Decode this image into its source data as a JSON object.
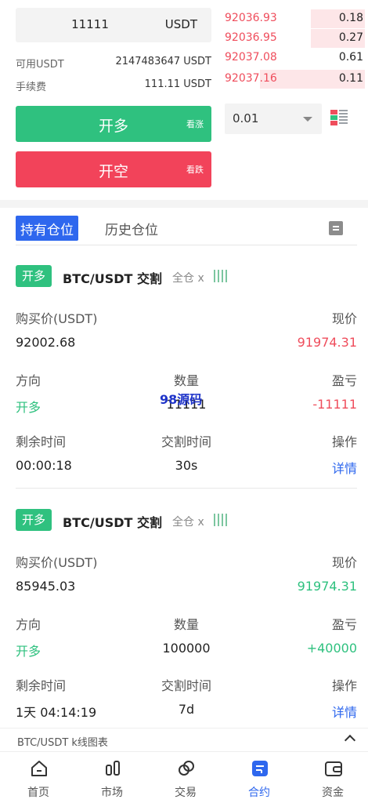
{
  "trade_form": {
    "amount_value": "11111",
    "amount_unit": "USDT",
    "available_label": "可用USDT",
    "available_value": "2147483647 USDT",
    "fee_label": "手续费",
    "fee_value": "111.11 USDT",
    "long_button": {
      "label": "开多",
      "sublabel": "看涨"
    },
    "short_button": {
      "label": "开空",
      "sublabel": "看跌"
    }
  },
  "order_book": {
    "asks": [
      {
        "price": "92036.93",
        "qty": "0.18",
        "depth": 0.38
      },
      {
        "price": "92036.95",
        "qty": "0.27",
        "depth": 0.38
      },
      {
        "price": "92037.08",
        "qty": "0.61",
        "depth": 0.0
      },
      {
        "price": "92037.16",
        "qty": "0.11",
        "depth": 0.74
      }
    ],
    "precision_value": "0.01",
    "colors": {
      "ask": "#ef4d5c",
      "ask_bg": "#fde6e8"
    }
  },
  "positions": {
    "tab_active": "持有仓位",
    "tab_history": "历史仓位",
    "cards": [
      {
        "side": "开多",
        "pair": "BTC/USDT 交割",
        "margin_mode": "全仓 x",
        "buy_price_label": "购买价(USDT)",
        "buy_price": "92002.68",
        "current_label": "现价",
        "current_price": "91974.31",
        "direction_label": "方向",
        "direction": "开多",
        "quantity_label": "数量",
        "quantity": "11111",
        "pnl_label": "盈亏",
        "pnl": "-11111",
        "remaining_label": "剩余时间",
        "remaining": "00:00:18",
        "delivery_label": "交割时间",
        "delivery": "30s",
        "action_label": "操作",
        "action": "详情"
      },
      {
        "side": "开多",
        "pair": "BTC/USDT 交割",
        "margin_mode": "全仓 x",
        "buy_price_label": "购买价(USDT)",
        "buy_price": "85945.03",
        "current_label": "现价",
        "current_price": "91974.31",
        "direction_label": "方向",
        "direction": "开多",
        "quantity_label": "数量",
        "quantity": "100000",
        "pnl_label": "盈亏",
        "pnl": "+40000",
        "remaining_label": "剩余时间",
        "remaining": "1天 04:14:19",
        "delivery_label": "交割时间",
        "delivery": "7d",
        "action_label": "操作",
        "action": "详情"
      }
    ]
  },
  "watermark": "98源码",
  "kline": {
    "label": "BTC/USDT k线图表"
  },
  "nav": {
    "items": [
      {
        "label": "首页",
        "icon": "home-icon"
      },
      {
        "label": "市场",
        "icon": "market-icon"
      },
      {
        "label": "交易",
        "icon": "trade-icon"
      },
      {
        "label": "合约",
        "icon": "contract-icon"
      },
      {
        "label": "资金",
        "icon": "wallet-icon"
      }
    ],
    "active": "合约"
  },
  "colors": {
    "green": "#2fc17f",
    "red": "#f2435a",
    "blue": "#2e67ee"
  }
}
